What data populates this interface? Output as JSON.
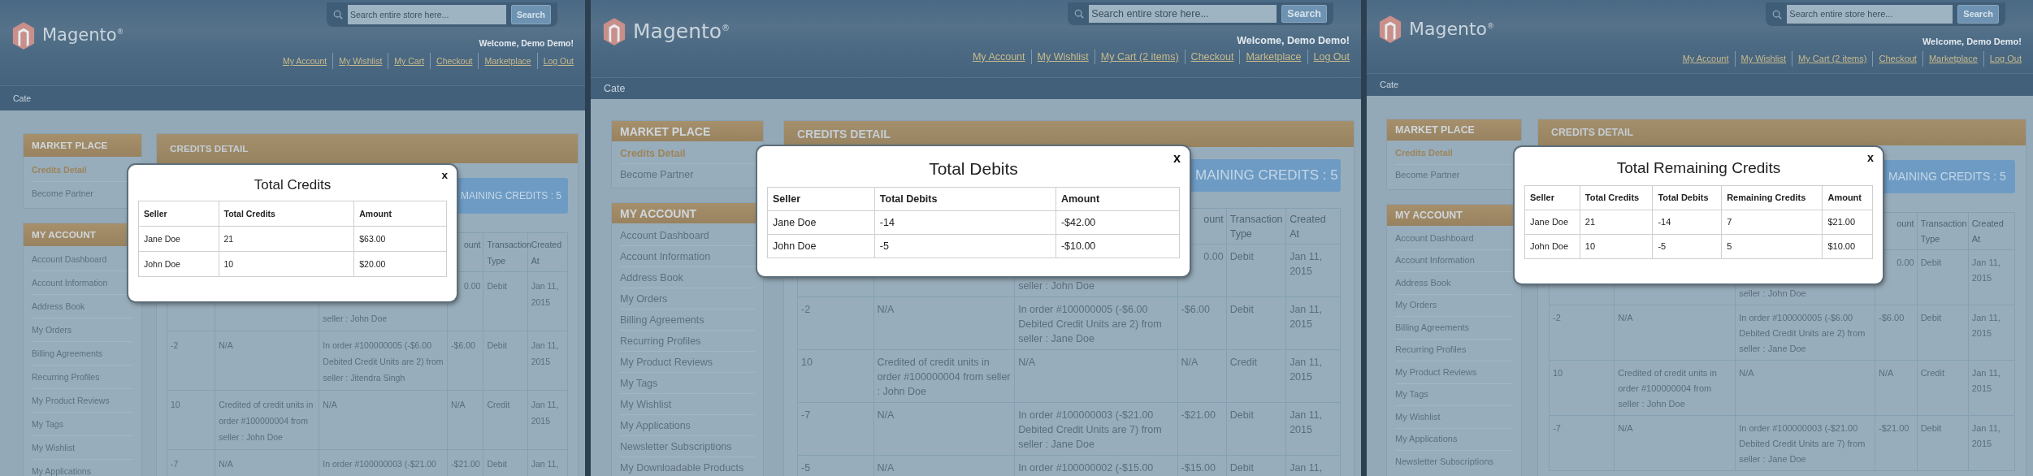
{
  "panels": [
    {
      "header": {
        "logo": "Magento$^{®}$",
        "search": {
          "placeholder": "Search entire store here..."
        },
        "search_button": "Search",
        "welcome": "Welcome, Demo Demo!",
        "links": [
          "My Account",
          "My Wishlist",
          "My Cart",
          "Checkout",
          "Marketplace",
          "Log Out"
        ]
      },
      "nav": [
        "Cate"
      ],
      "sidebar": [
        {
          "title": "MARKET PLACE",
          "items": [
            {
              "label": "Credits Detail",
              "selected": true
            },
            {
              "label": "Become Partner",
              "selected": false
            }
          ]
        },
        {
          "title": "MY ACCOUNT",
          "items": [
            {
              "label": "Account Dashboard",
              "selected": false
            },
            {
              "label": "Account Information",
              "selected": false
            },
            {
              "label": "Address Book",
              "selected": false
            },
            {
              "label": "My Orders",
              "selected": false
            },
            {
              "label": "Billing Agreements",
              "selected": false
            },
            {
              "label": "Recurring Profiles",
              "selected": false
            },
            {
              "label": "My Product Reviews",
              "selected": false
            },
            {
              "label": "My Tags",
              "selected": false
            },
            {
              "label": "My Wishlist",
              "selected": false
            },
            {
              "label": "My Applications",
              "selected": false
            }
          ]
        }
      ],
      "main": {
        "title": "CREDITS DETAIL",
        "remaining_button": "MAINING CREDITS : 5",
        "table": {
          "columns": {
            "column_4": "ount",
            "column_5": "Transaction Type",
            "column_6": "Created At"
          },
          "rows": [
            {
              "column_3": "seller : John Doe",
              "column_4": "0.00",
              "column_5": "Debit",
              "column_6": "Jan 11, 2015"
            },
            {
              "column_1": "-2",
              "column_2": "N/A",
              "column_3": "In order #100000005 (-$6.00 Debited Credit Units are 2) from seller : Jitendra Singh",
              "column_4": "-$6.00",
              "column_5": "Debit",
              "column_6": "Jan 11, 2015"
            },
            {
              "column_1": "10",
              "column_2": "Credited of credit units in order #100000004 from seller : John Doe",
              "column_3": "N/A",
              "column_4": "N/A",
              "column_5": "Credit",
              "column_6": "Jan 11, 2015"
            },
            {
              "column_1": "-7",
              "column_2": "N/A",
              "column_3": "In order #100000003 (-$21.00",
              "column_4": "-$21.00",
              "column_5": "Debit",
              "column_6": "Jan 11,"
            }
          ]
        }
      },
      "modal": {
        "title": "Total Credits",
        "close": "x",
        "columns": [
          "Seller",
          "Total Credits",
          "Amount"
        ],
        "rows": [
          [
            "Jane Doe",
            "21",
            "$63.00"
          ],
          [
            "John Doe",
            "10",
            "$20.00"
          ]
        ]
      }
    },
    {
      "header": {
        "logo": "Magento$^{®}$",
        "search": {
          "placeholder": "Search entire store here..."
        },
        "search_button": "Search",
        "welcome": "Welcome, Demo Demo!",
        "links": [
          "My Account",
          "My Wishlist",
          "My Cart (2 items)",
          "Checkout",
          "Marketplace",
          "Log Out"
        ]
      },
      "nav": [
        "Cate"
      ],
      "sidebar": [
        {
          "title": "MARKET PLACE",
          "items": [
            {
              "label": "Credits Detail",
              "selected": true
            },
            {
              "label": "Become Partner",
              "selected": false
            }
          ]
        },
        {
          "title": "MY ACCOUNT",
          "items": [
            {
              "label": "Account Dashboard",
              "selected": false
            },
            {
              "label": "Account Information",
              "selected": false
            },
            {
              "label": "Address Book",
              "selected": false
            },
            {
              "label": "My Orders",
              "selected": false
            },
            {
              "label": "Billing Agreements",
              "selected": false
            },
            {
              "label": "Recurring Profiles",
              "selected": false
            },
            {
              "label": "My Product Reviews",
              "selected": false
            },
            {
              "label": "My Tags",
              "selected": false
            },
            {
              "label": "My Wishlist",
              "selected": false
            },
            {
              "label": "My Applications",
              "selected": false
            },
            {
              "label": "Newsletter Subscriptions",
              "selected": false
            },
            {
              "label": "My Downloadable Products",
              "selected": false
            }
          ]
        }
      ],
      "main": {
        "title": "CREDITS DETAIL",
        "remaining_button": "MAINING CREDITS : 5",
        "table": {
          "columns": {
            "column_4": "ount",
            "column_5": "Transaction Type",
            "column_6": "Created At"
          },
          "rows": [
            {
              "column_3": "seller : John Doe",
              "column_4": "0.00",
              "column_5": "Debit",
              "column_6": "Jan 11, 2015"
            },
            {
              "column_1": "-2",
              "column_2": "N/A",
              "column_3": "In order #100000005 (-$6.00 Debited Credit Units are 2) from seller : Jane Doe",
              "column_4": "-$6.00",
              "column_5": "Debit",
              "column_6": "Jan 11, 2015"
            },
            {
              "column_1": "10",
              "column_2": "Credited of credit units in order #100000004 from seller : John Doe",
              "column_3": "N/A",
              "column_4": "N/A",
              "column_5": "Credit",
              "column_6": "Jan 11, 2015"
            },
            {
              "column_1": "-7",
              "column_2": "N/A",
              "column_3": "In order #100000003 (-$21.00 Debited Credit Units are 7) from seller : Jane Doe",
              "column_4": "-$21.00",
              "column_5": "Debit",
              "column_6": "Jan 11, 2015"
            },
            {
              "column_1": "-5",
              "column_2": "N/A",
              "column_3": "In order #100000002 (-$15.00",
              "column_4": "-$15.00",
              "column_5": "Debit",
              "column_6": "Jan 11,"
            }
          ]
        }
      },
      "modal": {
        "title": "Total Debits",
        "close": "x",
        "columns": [
          "Seller",
          "Total Debits",
          "Amount"
        ],
        "rows": [
          [
            "Jane Doe",
            "-14",
            "-$42.00"
          ],
          [
            "John Doe",
            "-5",
            "-$10.00"
          ]
        ]
      }
    },
    {
      "header": {
        "logo": "Magento$^{®}$",
        "search": {
          "placeholder": "Search entire store here..."
        },
        "search_button": "Search",
        "welcome": "Welcome, Demo Demo!",
        "links": [
          "My Account",
          "My Wishlist",
          "My Cart (2 items)",
          "Checkout",
          "Marketplace",
          "Log Out"
        ]
      },
      "nav": [
        "Cate"
      ],
      "sidebar": [
        {
          "title": "MARKET PLACE",
          "items": [
            {
              "label": "Credits Detail",
              "selected": true
            },
            {
              "label": "Become Partner",
              "selected": false
            }
          ]
        },
        {
          "title": "MY ACCOUNT",
          "items": [
            {
              "label": "Account Dashboard",
              "selected": false
            },
            {
              "label": "Account Information",
              "selected": false
            },
            {
              "label": "Address Book",
              "selected": false
            },
            {
              "label": "My Orders",
              "selected": false
            },
            {
              "label": "Billing Agreements",
              "selected": false
            },
            {
              "label": "Recurring Profiles",
              "selected": false
            },
            {
              "label": "My Product Reviews",
              "selected": false
            },
            {
              "label": "My Tags",
              "selected": false
            },
            {
              "label": "My Wishlist",
              "selected": false
            },
            {
              "label": "My Applications",
              "selected": false
            },
            {
              "label": "Newsletter Subscriptions",
              "selected": false
            }
          ]
        }
      ],
      "main": {
        "title": "CREDITS DETAIL",
        "remaining_button": "MAINING CREDITS : 5",
        "table": {
          "columns": {
            "column_4": "ount",
            "column_5": "Transaction Type",
            "column_6": "Created At"
          },
          "rows": [
            {
              "column_3": "seller : John Doe",
              "column_4": "0.00",
              "column_5": "Debit",
              "column_6": "Jan 11, 2015"
            },
            {
              "column_1": "-2",
              "column_2": "N/A",
              "column_3": "In order #100000005 (-$6.00 Debited Credit Units are 2) from seller : Jane Doe",
              "column_4": "-$6.00",
              "column_5": "Debit",
              "column_6": "Jan 11, 2015"
            },
            {
              "column_1": "10",
              "column_2": "Credited of credit units in order #100000004 from seller : John Doe",
              "column_3": "N/A",
              "column_4": "N/A",
              "column_5": "Credit",
              "column_6": "Jan 11, 2015"
            },
            {
              "column_1": "-7",
              "column_2": "N/A",
              "column_3": "In order #100000003 (-$21.00 Debited Credit Units are 7) from seller : Jane Doe",
              "column_4": "-$21.00",
              "column_5": "Debit",
              "column_6": "Jan 11, 2015"
            }
          ]
        }
      },
      "modal": {
        "title": "Total Remaining Credits",
        "close": "x",
        "columns": [
          "Seller",
          "Total Credits",
          "Total Debits",
          "Remaining Credits",
          "Amount"
        ],
        "rows": [
          [
            "Jane Doe",
            "21",
            "-14",
            "7",
            "$21.00"
          ],
          [
            "John Doe",
            "10",
            "-5",
            "5",
            "$10.00"
          ]
        ]
      }
    }
  ]
}
